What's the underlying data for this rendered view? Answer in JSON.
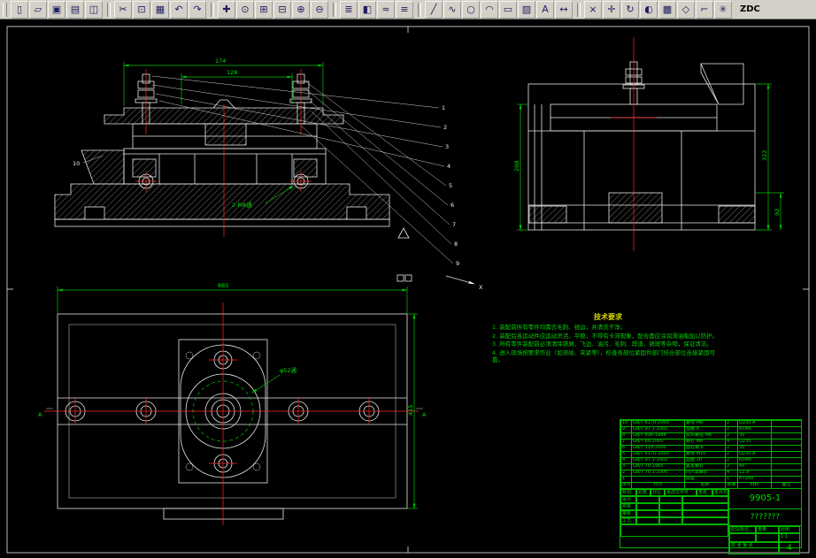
{
  "toolbar": {
    "label": "ZDC",
    "icons": [
      {
        "name": "new-icon",
        "glyph": "▯"
      },
      {
        "name": "open-icon",
        "glyph": "▱"
      },
      {
        "name": "save-icon",
        "glyph": "▣"
      },
      {
        "name": "print-icon",
        "glyph": "▤"
      },
      {
        "name": "preview-icon",
        "glyph": "◫"
      },
      {
        "sep": true
      },
      {
        "name": "cut-icon",
        "glyph": "✂"
      },
      {
        "name": "copy-icon",
        "glyph": "⊡"
      },
      {
        "name": "paste-icon",
        "glyph": "▦"
      },
      {
        "name": "undo-icon",
        "glyph": "↶"
      },
      {
        "name": "redo-icon",
        "glyph": "↷"
      },
      {
        "sep": true
      },
      {
        "name": "pan-icon",
        "glyph": "✚"
      },
      {
        "name": "zoom-realtime-icon",
        "glyph": "⊙"
      },
      {
        "name": "zoom-window-icon",
        "glyph": "⊞"
      },
      {
        "name": "zoom-previous-icon",
        "glyph": "⊟"
      },
      {
        "name": "zoom-in-icon",
        "glyph": "⊕"
      },
      {
        "name": "zoom-out-icon",
        "glyph": "⊖"
      },
      {
        "sep": true
      },
      {
        "name": "layers-icon",
        "glyph": "≣"
      },
      {
        "name": "layer-color-icon",
        "glyph": "◧"
      },
      {
        "name": "linetype-icon",
        "glyph": "≈"
      },
      {
        "name": "properties-icon",
        "glyph": "≡"
      },
      {
        "sep": true
      },
      {
        "name": "line-icon",
        "glyph": "╱"
      },
      {
        "name": "polyline-icon",
        "glyph": "∿"
      },
      {
        "name": "circle-icon",
        "glyph": "○"
      },
      {
        "name": "arc-icon",
        "glyph": "◠"
      },
      {
        "name": "rectangle-icon",
        "glyph": "▭"
      },
      {
        "name": "hatch-icon",
        "glyph": "▨"
      },
      {
        "name": "text-icon",
        "glyph": "A"
      },
      {
        "name": "dimension-icon",
        "glyph": "↔"
      },
      {
        "sep": true
      },
      {
        "name": "erase-icon",
        "glyph": "×"
      },
      {
        "name": "move-icon",
        "glyph": "✛"
      },
      {
        "name": "rotate-icon",
        "glyph": "↻"
      },
      {
        "name": "mirror-icon",
        "glyph": "◐"
      },
      {
        "name": "array-icon",
        "glyph": "▩"
      },
      {
        "name": "osnap-icon",
        "glyph": "◇"
      },
      {
        "name": "ucs-icon",
        "glyph": "⌐"
      },
      {
        "name": "redraw-icon",
        "glyph": "✳"
      }
    ]
  },
  "views": {
    "front": {
      "dim_174": "174",
      "dim_128": "128",
      "thread_note": "2-M8通",
      "part_label_10": "10",
      "balloons": [
        "1",
        "2",
        "3",
        "4",
        "5",
        "6",
        "7",
        "8",
        "9"
      ]
    },
    "side": {
      "dim_322": "322",
      "dim_92": "92",
      "dim_208": "208"
    },
    "plan": {
      "dim_885": "885",
      "dim_415": "415",
      "bore_note": "φ52通",
      "section_label": "A"
    },
    "axis_label": "X"
  },
  "notes": {
    "title": "技术要求",
    "lines": [
      "1. 装配前所有零件均需去毛刺、锐边，并清洗干净。",
      "2. 装配后各运动件应运动灵活、平稳，不得有卡滞现象，配合面应涂润滑油脂加以防护。",
      "3. 所有零件装配前必须清除铁屑、飞边、油污、毛刺、焊渣、锈斑等杂物，保证清洁。",
      "4. 进入现场按要求作业（如测绘、夹紧等），检查各部位紧固件部门结合部位连接紧固可靠。"
    ]
  },
  "bom": {
    "headers": [
      "序号",
      "代号",
      "名称",
      "数量",
      "材料",
      "备注"
    ],
    "rows": [
      [
        "10",
        "GB/T 6170-2000",
        "螺母 M8",
        "2",
        "Q235-A",
        ""
      ],
      [
        "9",
        "GB/T 97.1-2002",
        "垫圈 8",
        "2",
        "65Mn",
        ""
      ],
      [
        "8",
        "GB/T 898-1988",
        "双头螺柱 M8",
        "2",
        "35",
        ""
      ],
      [
        "7",
        "GB/T 68-2000",
        "螺钉 M6",
        "4",
        "Q235",
        ""
      ],
      [
        "6",
        "GB/T 119-2000",
        "圆柱销 6",
        "2",
        "35",
        ""
      ],
      [
        "5",
        "GB/T 6170-2000",
        "螺母 M10",
        "2",
        "Q235-A",
        ""
      ],
      [
        "4",
        "GB/T 97.1-2002",
        "垫圈 10",
        "2",
        "65Mn",
        ""
      ],
      [
        "3",
        "GB/T 78-1985",
        "紧定螺钉",
        "2",
        "45",
        ""
      ],
      [
        "2",
        "GB/T 70.1-2000",
        "内六角螺钉",
        "4",
        "12.9",
        ""
      ],
      [
        "1",
        "",
        "底座",
        "1",
        "HT200",
        ""
      ]
    ]
  },
  "title_block": {
    "drawing_no": "9905-1",
    "part_name": "???????",
    "row1": [
      "标记",
      "处数",
      "分区",
      "更改文件号",
      "签名",
      "年月日"
    ],
    "roles": [
      "设计",
      "校核",
      "审核",
      "工艺"
    ],
    "stage_label": "阶段标记",
    "weight_label": "重量",
    "scale_label": "比例",
    "scale_value": "1:1",
    "sheet_note": "共 张 第 张",
    "sheet_no": "4"
  }
}
